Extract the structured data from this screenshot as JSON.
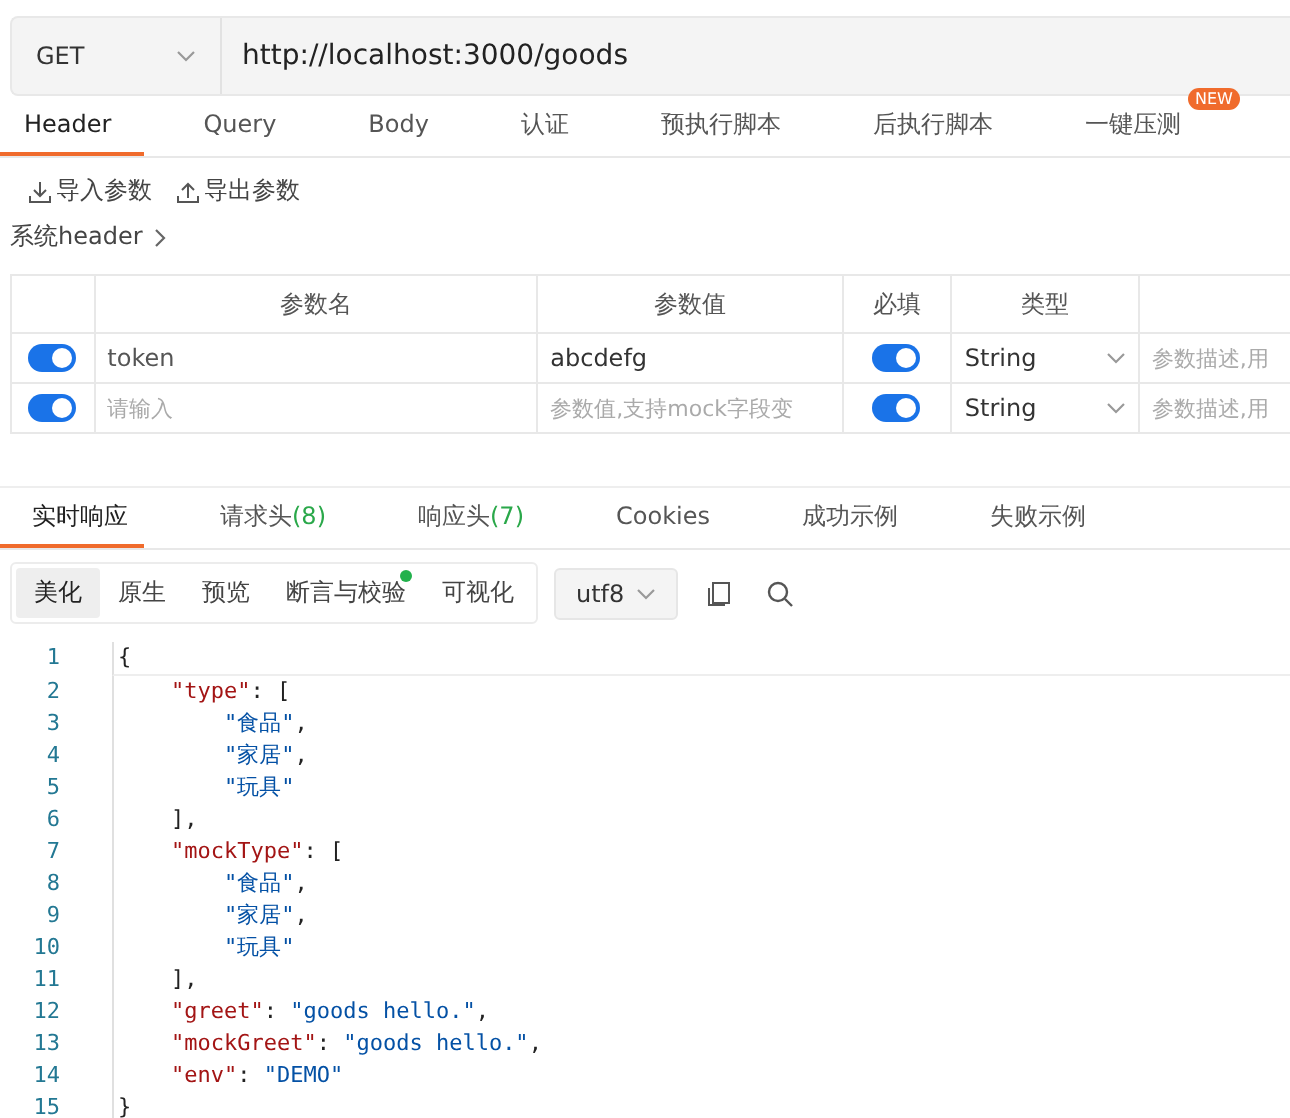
{
  "request": {
    "method": "GET",
    "url": "http://localhost:3000/goods"
  },
  "request_tabs": [
    {
      "label": "Header",
      "selected": true
    },
    {
      "label": "Query",
      "selected": false
    },
    {
      "label": "Body",
      "selected": false
    },
    {
      "label": "认证",
      "selected": false
    },
    {
      "label": "预执行脚本",
      "selected": false
    },
    {
      "label": "后执行脚本",
      "selected": false
    },
    {
      "label": "一键压测",
      "selected": false,
      "badge": "NEW"
    }
  ],
  "actions": [
    {
      "label": "导入参数",
      "kind": "import"
    },
    {
      "label": "导出参数",
      "kind": "export"
    }
  ],
  "system_header": "系统header",
  "params_table": {
    "columns": [
      "参数名",
      "参数值",
      "必填",
      "类型"
    ],
    "rows": [
      {
        "enabled": true,
        "name": "token",
        "value": "abcdefg",
        "required": true,
        "type": "String",
        "description_placeholder": "参数描述,用"
      },
      {
        "enabled": true,
        "name_placeholder": "请输入",
        "value_placeholder": "参数值,支持mock字段变",
        "required": true,
        "type": "String",
        "description_placeholder": "参数描述,用"
      }
    ]
  },
  "response_tabs": [
    {
      "label": "实时响应",
      "selected": true
    },
    {
      "label": "请求头",
      "count": "(8)",
      "selected": false
    },
    {
      "label": "响应头",
      "count": "(7)",
      "selected": false
    },
    {
      "label": "Cookies",
      "selected": false
    },
    {
      "label": "成功示例",
      "selected": false
    },
    {
      "label": "失败示例",
      "selected": false
    }
  ],
  "view_modes": [
    {
      "label": "美化",
      "selected": true,
      "dot": false
    },
    {
      "label": "原生",
      "selected": false,
      "dot": false
    },
    {
      "label": "预览",
      "selected": false,
      "dot": false
    },
    {
      "label": "断言与校验",
      "selected": false,
      "dot": true
    },
    {
      "label": "可视化",
      "selected": false,
      "dot": false
    }
  ],
  "encoding": "utf8",
  "code": [
    {
      "number": "1",
      "tokens": [
        {
          "kind": "punct",
          "text": "{"
        }
      ]
    },
    {
      "number": "2",
      "tokens": [
        {
          "kind": "key",
          "text": "    \"type\""
        },
        {
          "kind": "punct",
          "text": ": ["
        }
      ]
    },
    {
      "number": "3",
      "tokens": [
        {
          "kind": "string",
          "text": "        \"食品\""
        },
        {
          "kind": "punct",
          "text": ","
        }
      ]
    },
    {
      "number": "4",
      "tokens": [
        {
          "kind": "string",
          "text": "        \"家居\""
        },
        {
          "kind": "punct",
          "text": ","
        }
      ]
    },
    {
      "number": "5",
      "tokens": [
        {
          "kind": "string",
          "text": "        \"玩具\""
        }
      ]
    },
    {
      "number": "6",
      "tokens": [
        {
          "kind": "punct",
          "text": "    ],"
        }
      ]
    },
    {
      "number": "7",
      "tokens": [
        {
          "kind": "key",
          "text": "    \"mockType\""
        },
        {
          "kind": "punct",
          "text": ": ["
        }
      ]
    },
    {
      "number": "8",
      "tokens": [
        {
          "kind": "string",
          "text": "        \"食品\""
        },
        {
          "kind": "punct",
          "text": ","
        }
      ]
    },
    {
      "number": "9",
      "tokens": [
        {
          "kind": "string",
          "text": "        \"家居\""
        },
        {
          "kind": "punct",
          "text": ","
        }
      ]
    },
    {
      "number": "10",
      "tokens": [
        {
          "kind": "string",
          "text": "        \"玩具\""
        }
      ]
    },
    {
      "number": "11",
      "tokens": [
        {
          "kind": "punct",
          "text": "    ],"
        }
      ]
    },
    {
      "number": "12",
      "tokens": [
        {
          "kind": "key",
          "text": "    \"greet\""
        },
        {
          "kind": "punct",
          "text": ": "
        },
        {
          "kind": "string",
          "text": "\"goods hello.\""
        },
        {
          "kind": "punct",
          "text": ","
        }
      ]
    },
    {
      "number": "13",
      "tokens": [
        {
          "kind": "key",
          "text": "    \"mockGreet\""
        },
        {
          "kind": "punct",
          "text": ": "
        },
        {
          "kind": "string",
          "text": "\"goods hello.\""
        },
        {
          "kind": "punct",
          "text": ","
        }
      ]
    },
    {
      "number": "14",
      "tokens": [
        {
          "kind": "key",
          "text": "    \"env\""
        },
        {
          "kind": "punct",
          "text": ": "
        },
        {
          "kind": "string",
          "text": "\"DEMO\""
        }
      ]
    },
    {
      "number": "15",
      "tokens": [
        {
          "kind": "punct",
          "text": "}"
        }
      ]
    }
  ]
}
